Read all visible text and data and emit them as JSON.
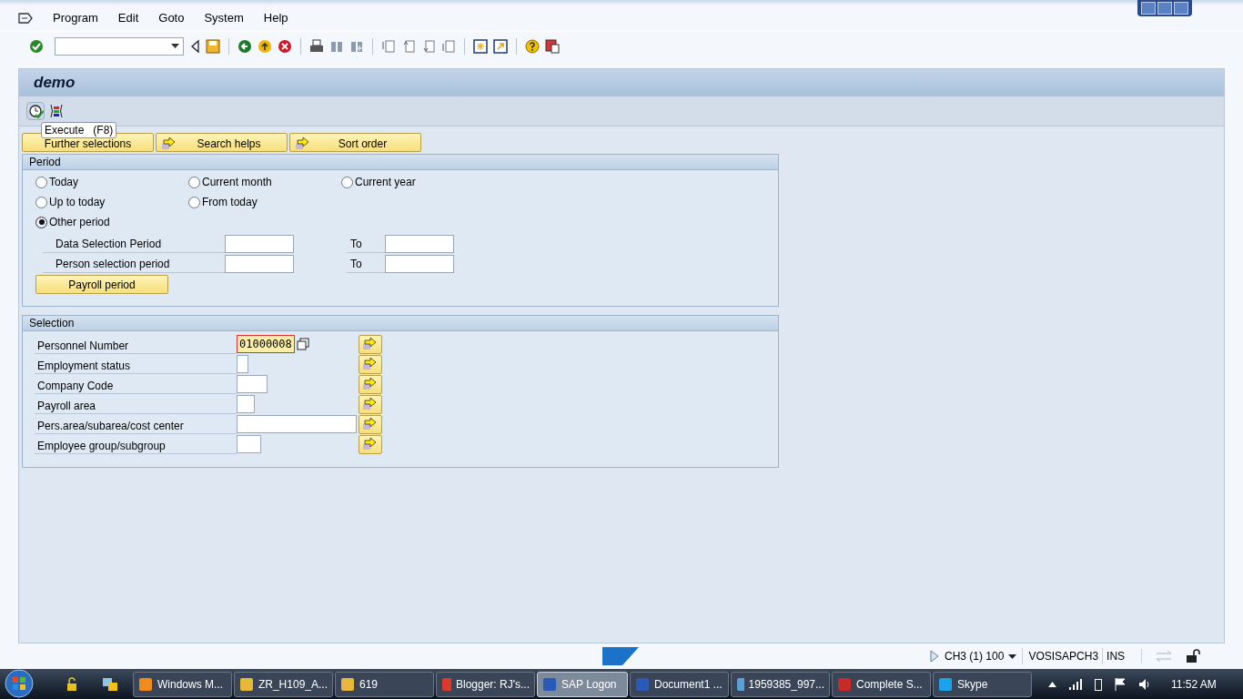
{
  "menu_bar": {
    "items": [
      "Program",
      "Edit",
      "Goto",
      "System",
      "Help"
    ]
  },
  "screen_title": "demo",
  "tooltip": "Execute   (F8)",
  "tab_buttons": [
    "Further selections",
    "Search helps",
    "Sort order"
  ],
  "period": {
    "title": "Period",
    "radios": [
      {
        "label": "Today",
        "selected": false
      },
      {
        "label": "Current month",
        "selected": false
      },
      {
        "label": "Current year",
        "selected": false
      },
      {
        "label": "Up to today",
        "selected": false
      },
      {
        "label": "From today",
        "selected": false
      },
      {
        "label": "Other period",
        "selected": true
      }
    ],
    "ranges": [
      {
        "label": "Data Selection Period",
        "to_label": "To"
      },
      {
        "label": "Person selection period",
        "to_label": "To"
      }
    ],
    "button": "Payroll period"
  },
  "selection": {
    "title": "Selection",
    "rows": [
      {
        "label": "Personnel Number",
        "value": "01000008",
        "focused": true
      },
      {
        "label": "Employment status",
        "focused": false
      },
      {
        "label": "Company Code",
        "focused": false
      },
      {
        "label": "Payroll area",
        "focused": false
      },
      {
        "label": "Pers.area/subarea/cost center",
        "focused": false
      },
      {
        "label": "Employee group/subgroup",
        "focused": false
      }
    ]
  },
  "status_bar": {
    "system": "CH3 (1) 100",
    "server": "VOSISAPCH3",
    "mode": "INS"
  },
  "taskbar": {
    "items": [
      {
        "label": "Windows M...",
        "selected": false
      },
      {
        "label": "ZR_H109_A...",
        "selected": false
      },
      {
        "label": "619",
        "selected": false
      },
      {
        "label": "Blogger: RJ's...",
        "selected": false
      },
      {
        "label": "SAP Logon",
        "selected": true
      },
      {
        "label": "Document1 ...",
        "selected": false
      },
      {
        "label": "1959385_997...",
        "selected": false
      },
      {
        "label": "Complete S...",
        "selected": false
      },
      {
        "label": "Skype",
        "selected": false
      }
    ],
    "time": "11:52 AM"
  }
}
